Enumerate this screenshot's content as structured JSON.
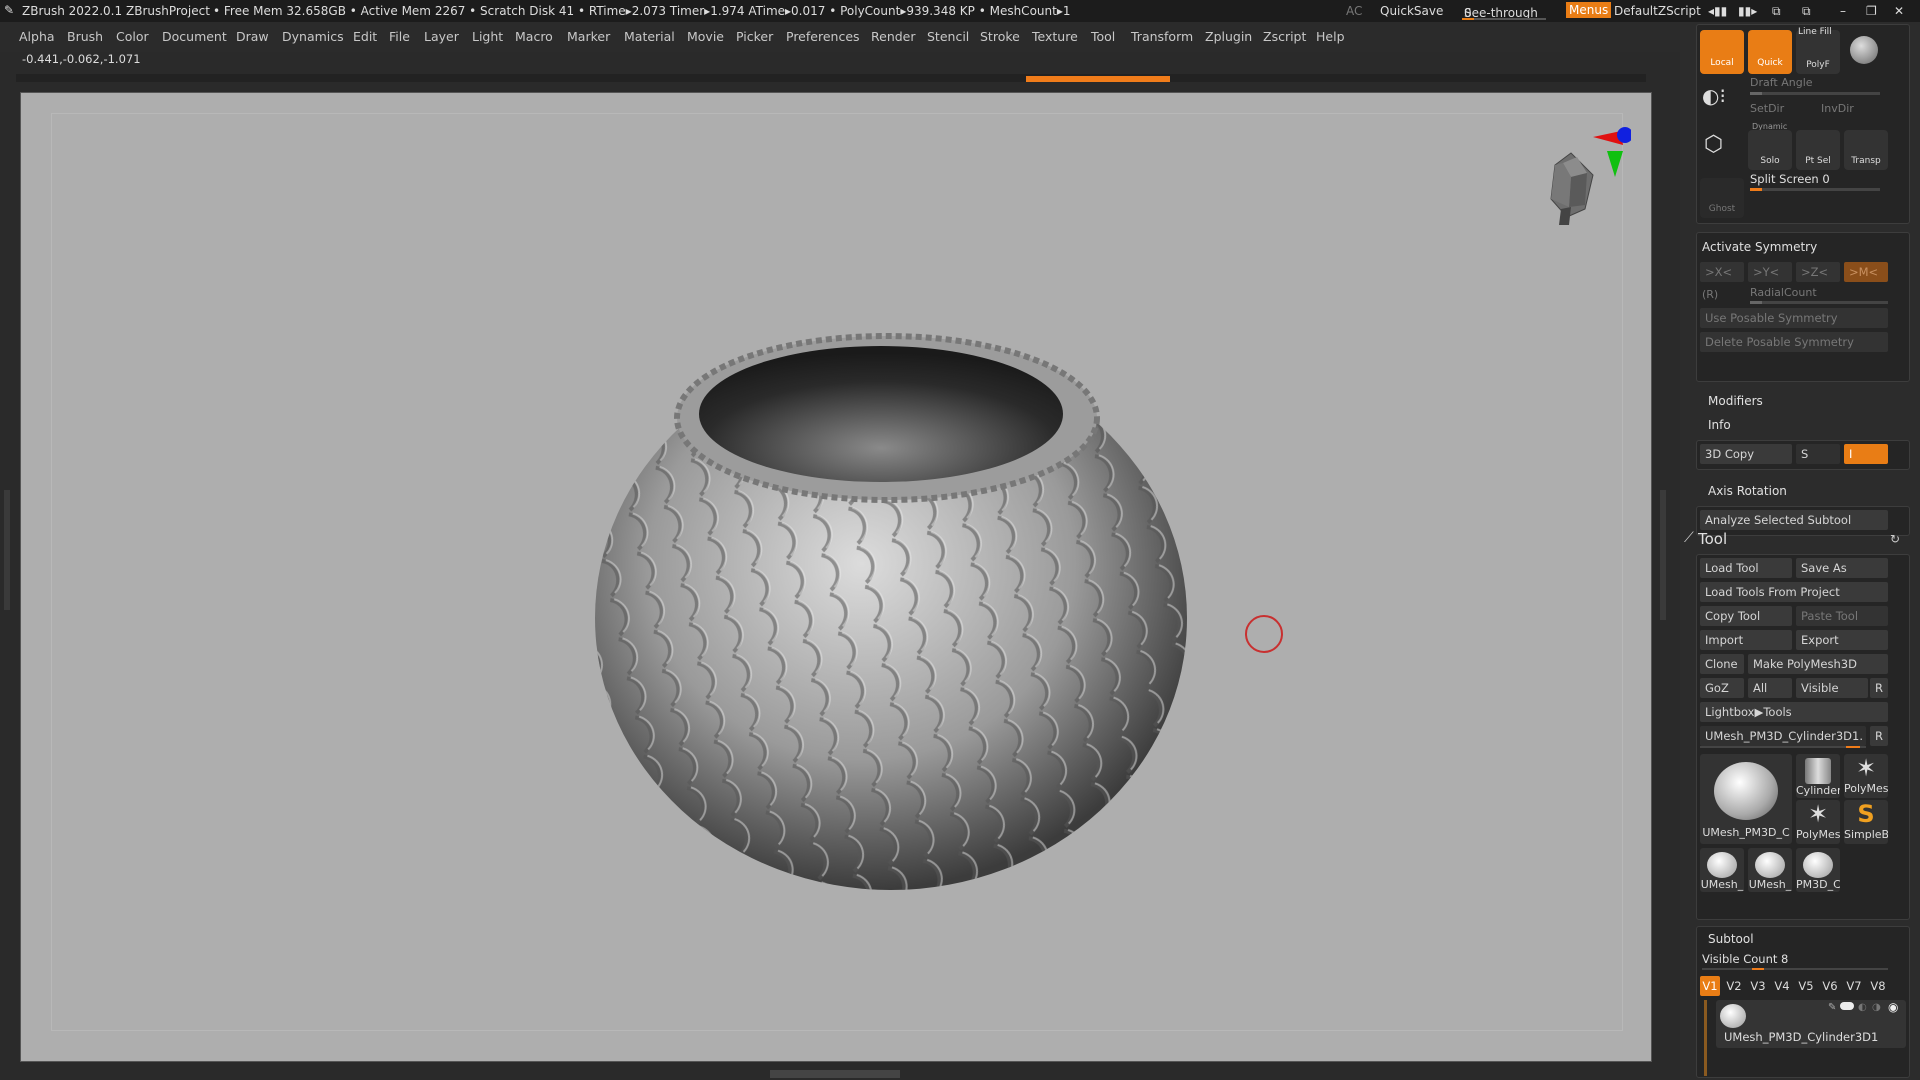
{
  "titlebar": {
    "app": "ZBrush 2022.0.1",
    "project": "ZBrushProject",
    "stats": "• Free Mem 32.658GB • Active Mem 2267 • Scratch Disk 41 • RTime▸2.073 Timer▸1.974 ATime▸0.017 • PolyCount▸939.348 KP • MeshCount▸1",
    "ac": "AC",
    "quicksave": "QuickSave",
    "seethrough": "See-through",
    "seethrough_value": "0",
    "menus": "Menus",
    "script": "DefaultZScript"
  },
  "menu": [
    "Alpha",
    "Brush",
    "Color",
    "Document",
    "Draw",
    "Dynamics",
    "Edit",
    "File",
    "Layer",
    "Light",
    "Macro",
    "Marker",
    "Material",
    "Movie",
    "Picker",
    "Preferences",
    "Render",
    "Stencil",
    "Stroke",
    "Texture",
    "Tool",
    "Transform",
    "Zplugin",
    "Zscript",
    "Help"
  ],
  "coords": "-0.441,-0.062,-1.071",
  "colors": {
    "accent": "#e97d15",
    "panel": "#2c2c2c",
    "viewport": "#aeaeae"
  },
  "topicons": {
    "local": "Local",
    "quick": "Quick",
    "linefill": "Line Fill",
    "polyf": "PolyF",
    "draft_angle": "Draft Angle",
    "setdir": "SetDir",
    "invdir": "InvDir",
    "dynamic": "Dynamic",
    "solo": "Solo",
    "ptsel": "Pt Sel",
    "transp": "Transp",
    "ghost": "Ghost",
    "split_screen": "Split Screen",
    "split_value": "0"
  },
  "symmetry": {
    "activate": "Activate Symmetry",
    "x": ">X<",
    "y": ">Y<",
    "z": ">Z<",
    "m": ">M<",
    "r": "(R)",
    "radialcount": "RadialCount",
    "use_posable": "Use Posable Symmetry",
    "delete_posable": "Delete Posable Symmetry"
  },
  "modifiers": "Modifiers",
  "info": "Info",
  "copy3d": "3D Copy",
  "copy3d_s": "S",
  "copy3d_i": "I",
  "axis_rotation": "Axis Rotation",
  "analyze": "Analyze Selected Subtool",
  "tool": {
    "title": "Tool",
    "load": "Load Tool",
    "saveas": "Save As",
    "loadproject": "Load Tools From Project",
    "copy": "Copy Tool",
    "paste": "Paste Tool",
    "import": "Import",
    "export": "Export",
    "clone": "Clone",
    "polymesh": "Make PolyMesh3D",
    "goz": "GoZ",
    "all": "All",
    "visible": "Visible",
    "r": "R",
    "lightbox": "Lightbox▶Tools",
    "current": "UMesh_PM3D_Cylinder3D1.",
    "thumbs": [
      "UMesh_PM3D_C",
      "Cylinder",
      "PolyMes",
      "PolyMes",
      "SimpleB",
      "UMesh_",
      "UMesh_",
      "PM3D_C"
    ]
  },
  "subtool": {
    "title": "Subtool",
    "visible_count": "Visible Count",
    "visible_value": "8",
    "tabs": [
      "V1",
      "V2",
      "V3",
      "V4",
      "V5",
      "V6",
      "V7",
      "V8"
    ],
    "item": "UMesh_PM3D_Cylinder3D1"
  }
}
